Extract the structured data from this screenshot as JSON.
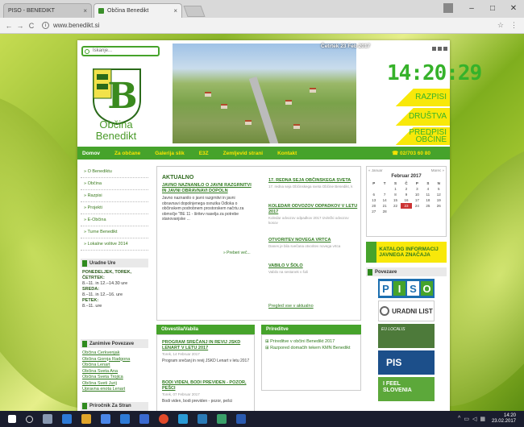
{
  "browser": {
    "tabs": [
      {
        "label": "PISO - BENEDIKT"
      },
      {
        "label": "Občina Benedikt"
      }
    ],
    "url": "www.benedikt.si"
  },
  "site": {
    "search_placeholder": "Iskanje...",
    "logo_line1": "Občina",
    "logo_line2": "Benedikt",
    "date": "Četrtek 23 Feb 2017",
    "clock": "14:20:29",
    "buttons": [
      {
        "label": "RAZPISI"
      },
      {
        "label": "DRUŠTVA"
      },
      {
        "label1": "PREDPISI",
        "label2": "OBČINE"
      }
    ],
    "menu": [
      {
        "label": "Domov"
      },
      {
        "label": "Za občane"
      },
      {
        "label": "Galerija slik"
      },
      {
        "label": "E3Z"
      },
      {
        "label": "Zemljevid strani"
      },
      {
        "label": "Kontakt"
      }
    ],
    "phone": "02/703 60 80",
    "left_nav": [
      {
        "label": "» O Benediktu"
      },
      {
        "label": "» Občina"
      },
      {
        "label": "» Razpisi"
      },
      {
        "label": "» Projekti"
      },
      {
        "label": "» E-Občina"
      },
      {
        "label": "» Turne Benedikt"
      },
      {
        "label": "» Lokalne volitve 2014"
      }
    ],
    "uradne_ure": {
      "title": "Uradne Ure",
      "l1": "PONEDELJEK, TOREK,",
      "l2": "ČETRTEK:",
      "l3": "8.–11. in 12.–14.30 ure",
      "l4": "SREDA:",
      "l5": "8.–11. in 12.–16. ure",
      "l6": "PETEK:",
      "l7": "8.–11. ure"
    },
    "povezave_left": {
      "title": "Zanimive Povezave",
      "links": [
        {
          "label": "Občina Cerkvenjak"
        },
        {
          "label": "Občina Gornja Radgona"
        },
        {
          "label": "Občina Lenart"
        },
        {
          "label": "Občina Sveta Ana"
        },
        {
          "label": "Občina Sveta Trojica"
        },
        {
          "label": "Občina Sveti Jurij"
        },
        {
          "label": "Upravna enota Lenart"
        }
      ]
    },
    "bottom_left_title": "Priročnik Za Stran",
    "aktualno": {
      "title": "AKTUALNO",
      "a1_title": "JAVNO NAZNANILO O JAVNI RAZGRNITVI IN JAVNI OBRAVNAVI DOPOLN",
      "a1_text": "Javno naznanilo o javni razgrnitvi in javni obravnavi dopolnjenega osnutka Odloka o občinskem podrobnem prostorskem načrtu za območje \"BE 11 - širitev naselja za potrebe stanovanjske ...",
      "a1_more": "» Preberi več...",
      "a2_title": "17. REDNA SEJA OBČINSKEGA SVETA",
      "a2_text": "17. redna seja Občinskega sveta Občine Benedikt, k",
      "a3_title": "KOLEDAR ODVOZOV ODPADKOV V LETU 2017",
      "a3_text": "Koledar odvozov odpadkov 2017 Izvlečki odvozov kosov",
      "a4_title": "OTVORITEV NOVEGA VRTCA",
      "a4_text": "Danes je bila svečana otvoritev novega vrtca",
      "a5_title": "VABILO V ŠOLO",
      "a5_text": "Vabilo na sestanek v šoli",
      "all": "Pregled vse v aktualno"
    },
    "obvestila": {
      "title": "Obvestila/Vabila",
      "a1_title": "PROGRAM SREČANJ IN REVIJ JSKD LENART V LETU 2017",
      "a1_date": "Torek, 14 Februar 2017",
      "a1_text": "Program srečanj in revij JSKD Lenart v letu 2017",
      "a2_title": "BODI VIDEN, BODI PREVIDEN - POZOR, PEŠCI",
      "a2_date": "Torek, 07 Februar 2017",
      "a2_text": "Bodi viden, bodi previden - pozor, pešci"
    },
    "prireditve": {
      "title": "Prireditve",
      "items": [
        {
          "label": "Prireditve v občini Benedikt 2017"
        },
        {
          "label": "Razpored domačih tekem KMN Benedikt"
        }
      ]
    },
    "calendar": {
      "prev": "« Januar",
      "next": "Marec »",
      "month": "Februar 2017",
      "days": [
        "P",
        "T",
        "S",
        "Č",
        "P",
        "S",
        "N"
      ],
      "weeks": [
        [
          "",
          "",
          "1",
          "2",
          "3",
          "4",
          "5"
        ],
        [
          "6",
          "7",
          "8",
          "9",
          "10",
          "11",
          "12"
        ],
        [
          "13",
          "14",
          "15",
          "16",
          "17",
          "18",
          "19"
        ],
        [
          "20",
          "21",
          "22",
          "23",
          "24",
          "25",
          "26"
        ],
        [
          "27",
          "28",
          "",
          "",
          "",
          "",
          ""
        ]
      ],
      "today": "23"
    },
    "katalog": "KATALOG INFORMACIJ JAVNEGA ZNAČAJA",
    "povezave_right": "Povezave",
    "banners": {
      "piso": [
        "P",
        "I",
        "S",
        "O"
      ],
      "ul": "URADNI LIST",
      "eu": "EU LOCALIS",
      "pis": "PIS",
      "feel1": "I FEEL",
      "feel2": "SLOVENIA"
    }
  },
  "taskbar": {
    "time": "14:20",
    "date": "23.02.2017"
  }
}
